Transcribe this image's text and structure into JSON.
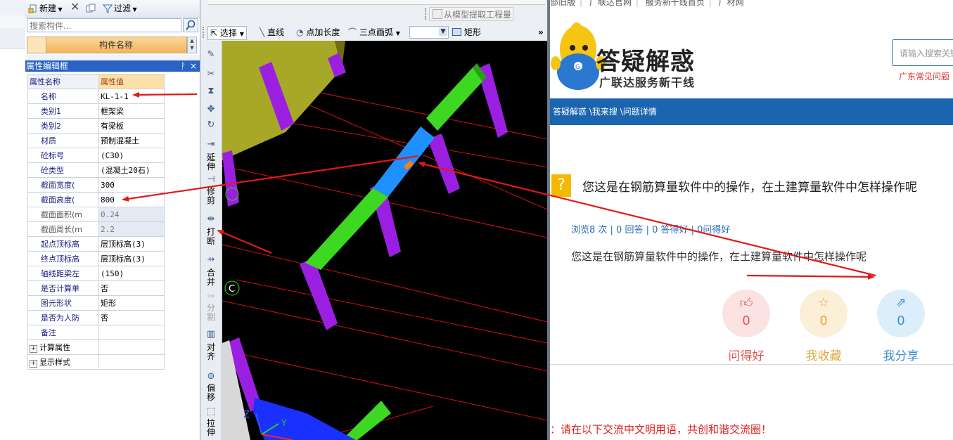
{
  "app": {
    "toolbar": {
      "new_label": "新建",
      "filter_label": "过滤"
    },
    "search_placeholder": "搜索构件...",
    "component_header": "构件名称",
    "property_panel": {
      "title": "属性编辑框",
      "pin": "ᚹ",
      "close": "×",
      "col_name": "属性名称",
      "col_value": "属性值",
      "rows": [
        {
          "name": "名称",
          "value": "KL-1-1"
        },
        {
          "name": "类别1",
          "value": "框架梁"
        },
        {
          "name": "类别2",
          "value": "有梁板"
        },
        {
          "name": "材质",
          "value": "预制混凝土"
        },
        {
          "name": "砼标号",
          "value": "(C30)"
        },
        {
          "name": "砼类型",
          "value": "(混凝土20石)"
        },
        {
          "name": "截面宽度(",
          "value": "300"
        },
        {
          "name": "截面高度(",
          "value": "800"
        },
        {
          "name": "截面面积(m",
          "value": "0.24"
        },
        {
          "name": "截面周长(m",
          "value": "2.2"
        },
        {
          "name": "起点顶标高",
          "value": "层顶标高(3)"
        },
        {
          "name": "终点顶标高",
          "value": "层顶标高(3)"
        },
        {
          "name": "轴线距梁左",
          "value": "(150)"
        },
        {
          "name": "是否计算单",
          "value": "否"
        },
        {
          "name": "图元形状",
          "value": "矩形"
        },
        {
          "name": "是否为人防",
          "value": "否"
        },
        {
          "name": "备注",
          "value": ""
        }
      ],
      "groups": [
        "计算属性",
        "显示样式"
      ]
    },
    "model_extract_button": "从模型提取工程量",
    "draw_toolbar": {
      "select": "选择",
      "line": "直线",
      "point_length": "点加长度",
      "three_point_arc": "三点画弧",
      "rect": "矩形",
      "more": "»"
    },
    "vertical_tools": [
      "延伸",
      "修剪",
      "打断",
      "合并",
      "分割",
      "对齐",
      "偏移",
      "拉伸"
    ],
    "canvas": {
      "axis_label": "C",
      "z_label": "Z",
      "y_label": "Y"
    }
  },
  "web": {
    "top_links": [
      "部旧版",
      "广联达官网",
      "服务新干线首页",
      "广材网"
    ],
    "logo_title": "答疑解惑",
    "logo_subtitle": "广联达服务新干线",
    "search_placeholder": "请输入搜索关键",
    "faq_link": "广东常见问题",
    "breadcrumb": "答疑解惑 \\我来搜 \\问题详情",
    "question_icon": "?",
    "question_title": "您这是在钢筋算量软件中的操作，在土建算量软件中怎样操作呢",
    "stats": "浏览8 次 | 0 回答 | 0 答得好 | 0问得好",
    "question_body": "您这是在钢筋算量软件中的操作，在土建算量软件中怎样操作呢",
    "actions": [
      {
        "label": "问得好",
        "count": "0",
        "color": "#e0544f",
        "bg": "#fbe3e3"
      },
      {
        "label": "我收藏",
        "count": "0",
        "color": "#e0a640",
        "bg": "#fcefd7"
      },
      {
        "label": "我分享",
        "count": "0",
        "color": "#3b8fd6",
        "bg": "#dceefa"
      }
    ],
    "notice": "：请在以下交流中文明用语，共创和谐交流圈！"
  }
}
